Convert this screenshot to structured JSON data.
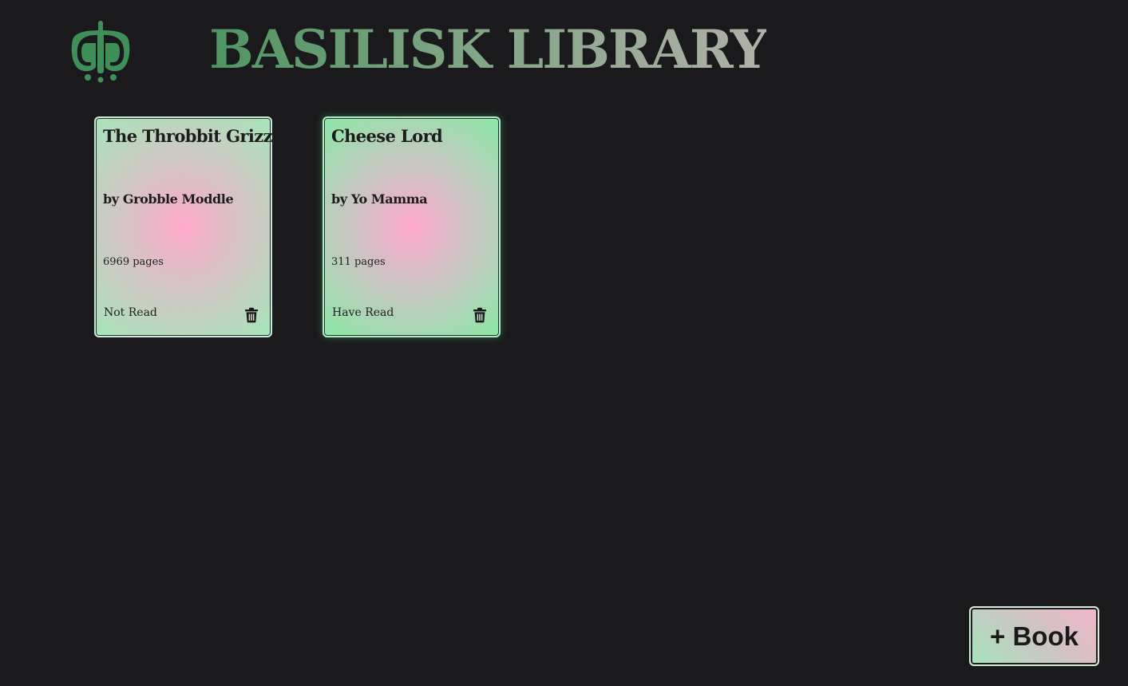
{
  "header": {
    "title": "BASILISK LIBRARY",
    "logo_icon": "basilisk-logo-icon"
  },
  "books": [
    {
      "title": "The Throbbit Grizz",
      "author": "by Grobble Moddle",
      "pages": "6969 pages",
      "status": "Not Read",
      "delete_icon": "trash-icon"
    },
    {
      "title": "Cheese Lord",
      "author": "by Yo Mamma",
      "pages": "311 pages",
      "status": "Have Read",
      "delete_icon": "trash-icon"
    }
  ],
  "actions": {
    "add_book_label": "+ Book"
  },
  "colors": {
    "background": "#1a1a1c",
    "logo_green": "#3f8f58",
    "card_pink": "#ffa9c9",
    "card_green": "#a6e5b9"
  }
}
